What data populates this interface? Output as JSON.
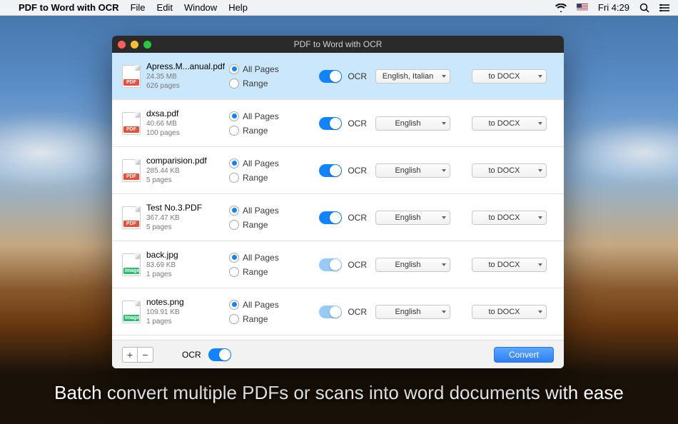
{
  "menubar": {
    "app_name": "PDF to Word with OCR",
    "items": [
      "File",
      "Edit",
      "Window",
      "Help"
    ],
    "clock": "Fri 4:29"
  },
  "window": {
    "title": "PDF to Word with OCR"
  },
  "page_options": {
    "all": "All Pages",
    "range": "Range"
  },
  "ocr_label": "OCR",
  "files": [
    {
      "name": "Apress.M...anual.pdf",
      "size": "24.35 MB",
      "pages": "626 pages",
      "type": "pdf",
      "selected": true,
      "ocr_on": true,
      "ocr_light": false,
      "lang": "English, Italian",
      "format": "to DOCX"
    },
    {
      "name": "dxsa.pdf",
      "size": "40.66 MB",
      "pages": "100 pages",
      "type": "pdf",
      "selected": false,
      "ocr_on": true,
      "ocr_light": false,
      "lang": "English",
      "format": "to DOCX"
    },
    {
      "name": "comparision.pdf",
      "size": "285.44 KB",
      "pages": "5 pages",
      "type": "pdf",
      "selected": false,
      "ocr_on": true,
      "ocr_light": false,
      "lang": "English",
      "format": "to DOCX"
    },
    {
      "name": "Test No.3.PDF",
      "size": "367.47 KB",
      "pages": "5 pages",
      "type": "pdf",
      "selected": false,
      "ocr_on": true,
      "ocr_light": false,
      "lang": "English",
      "format": "to DOCX"
    },
    {
      "name": "back.jpg",
      "size": "83.69 KB",
      "pages": "1 pages",
      "type": "img",
      "selected": false,
      "ocr_on": true,
      "ocr_light": true,
      "lang": "English",
      "format": "to DOCX"
    },
    {
      "name": "notes.png",
      "size": "109.91 KB",
      "pages": "1 pages",
      "type": "img",
      "selected": false,
      "ocr_on": true,
      "ocr_light": true,
      "lang": "English",
      "format": "to DOCX"
    }
  ],
  "file_badges": {
    "pdf": "PDF",
    "img": "Image"
  },
  "footer": {
    "ocr_label": "OCR",
    "convert": "Convert"
  },
  "caption": "Batch convert multiple PDFs or scans into word documents with ease"
}
